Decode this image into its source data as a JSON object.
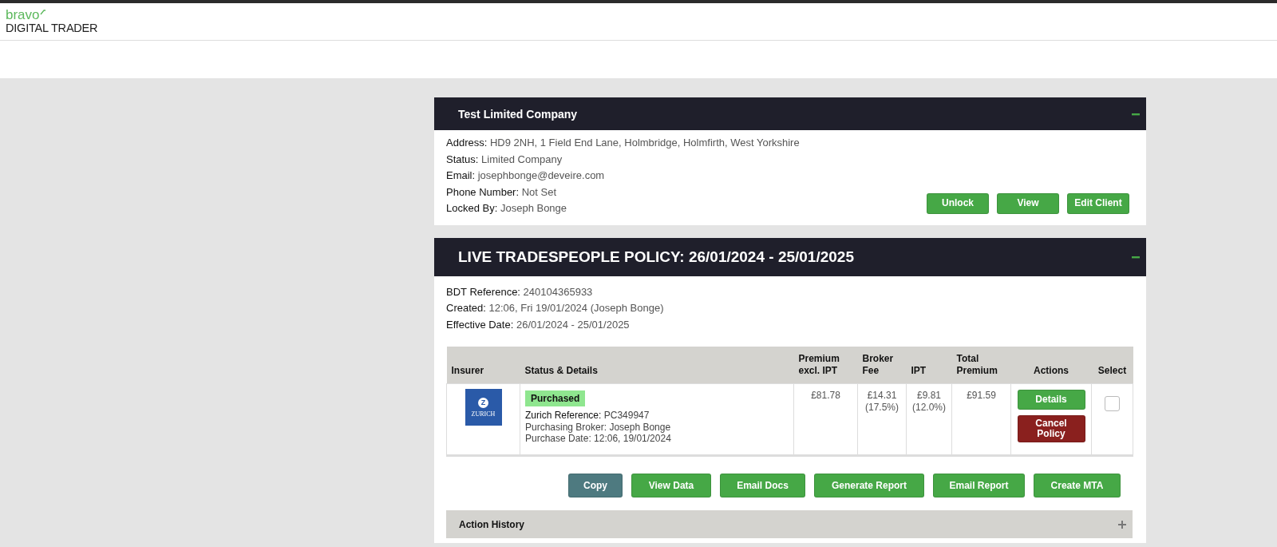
{
  "header": {
    "logo_top": "bravo",
    "logo_bottom": "DIGITAL TRADER"
  },
  "client": {
    "title": "Test Limited Company",
    "expanded": true,
    "fields": [
      {
        "label": "Address:",
        "value": "HD9 2NH, 1 Field End Lane, Holmbridge, Holmfirth, West Yorkshire"
      },
      {
        "label": "Status:",
        "value": "Limited Company"
      },
      {
        "label": "Email:",
        "value": "josephbonge@deveire.com"
      },
      {
        "label": "Phone Number:",
        "value": "Not Set"
      },
      {
        "label": "Locked By:",
        "value": "Joseph Bonge"
      }
    ],
    "buttons": [
      "Unlock",
      "View",
      "Edit Client"
    ]
  },
  "policy": {
    "title": "LIVE TRADESPEOPLE POLICY: 26/01/2024 - 25/01/2025",
    "expanded": true,
    "fields": [
      {
        "label": "BDT Reference:",
        "value": "240104365933"
      },
      {
        "label": "Created:",
        "value": "12:06, Fri 19/01/2024 (Joseph Bonge)"
      },
      {
        "label": "Effective Date:",
        "value": "26/01/2024 - 25/01/2025"
      }
    ],
    "table": {
      "columns": [
        "Insurer",
        "Status & Details",
        "Premium excl. IPT",
        "Broker Fee",
        "IPT",
        "Total Premium",
        "Actions",
        "Select"
      ],
      "rows": [
        {
          "insurer_mark": "Z",
          "insurer_name": "ZURICH",
          "status": "Purchased",
          "reference_label": "Zurich Reference:",
          "reference": "PC349947",
          "broker": "Purchasing Broker: Joseph Bonge",
          "purchase_date": "Purchase Date: 12:06, 19/01/2024",
          "premium": "£81.78",
          "broker_fee": "£14.31",
          "broker_fee_pct": "(17.5%)",
          "ipt": "£9.81",
          "ipt_pct": "(12.0%)",
          "total": "£91.59",
          "actions": [
            {
              "label": "Details",
              "kind": "primary"
            },
            {
              "label": "Cancel Policy",
              "kind": "danger"
            }
          ],
          "selected": false
        }
      ]
    },
    "buttons": [
      {
        "label": "Copy",
        "kind": "muted"
      },
      {
        "label": "View Data",
        "kind": "primary"
      },
      {
        "label": "Email Docs",
        "kind": "primary"
      },
      {
        "label": "Generate Report",
        "kind": "primary"
      },
      {
        "label": "Email Report",
        "kind": "primary"
      },
      {
        "label": "Create MTA",
        "kind": "primary"
      }
    ],
    "action_history": {
      "title": "Action History",
      "expanded": false
    }
  }
}
